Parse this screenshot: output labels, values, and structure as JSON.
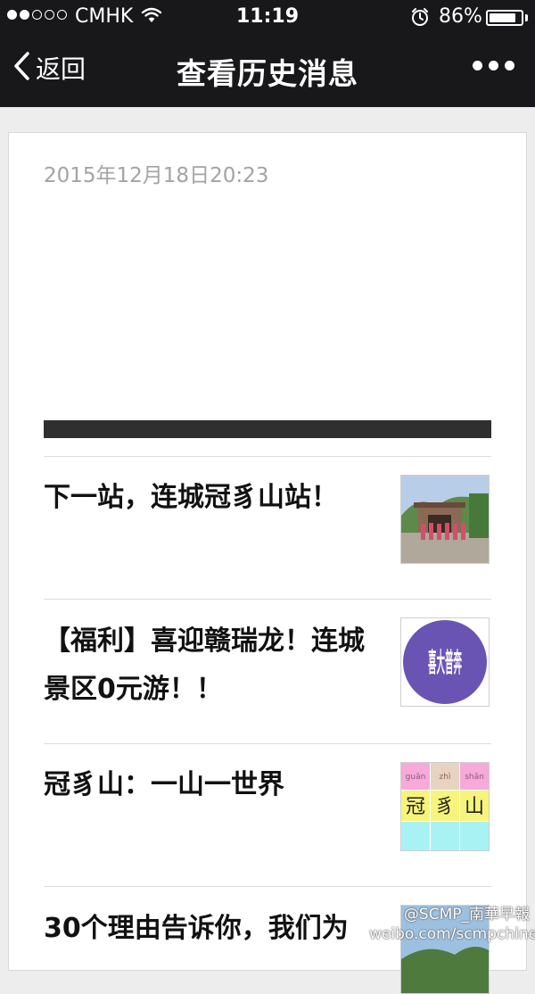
{
  "status_bar": {
    "carrier": "CMHK",
    "time": "11:19",
    "battery_percent": "86%",
    "battery_level": 0.86,
    "signal_bars_filled": 2,
    "signal_bars_total": 5
  },
  "nav": {
    "back_label": "返回",
    "title": "查看历史消息"
  },
  "message": {
    "date": "2015年12月18日20:23"
  },
  "articles": [
    {
      "title": "下一站，连城冠豸山站！"
    },
    {
      "title": "【福利】喜迎赣瑞龙！连城景区0元游！！"
    },
    {
      "title": "冠豸山：一山一世界"
    },
    {
      "title": "30个理由告诉你，我们为"
    }
  ],
  "thumbnails": {
    "welcome_badge": "喜大普奔",
    "grid_chars": [
      "冠",
      "豸",
      "山"
    ],
    "grid_pinyin": [
      "guān",
      "zhì",
      "shān"
    ]
  },
  "watermark": {
    "line1": "@SCMP_南華早報",
    "line2": "weibo.com/scmpchinese"
  },
  "colors": {
    "nav_bg": "#18181b",
    "page_bg": "#ededed",
    "date_text": "#a3a3a3"
  }
}
